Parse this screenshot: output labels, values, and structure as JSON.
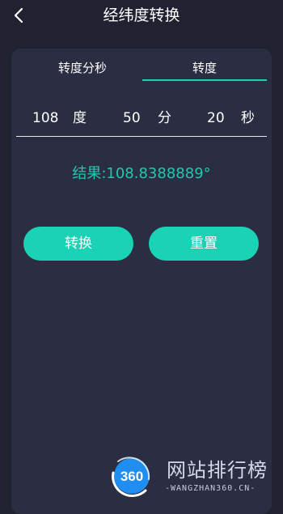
{
  "header": {
    "title": "经纬度转换"
  },
  "tabs": [
    {
      "label": "转度分秒"
    },
    {
      "label": "转度"
    }
  ],
  "inputs": {
    "degree_value": "108",
    "degree_unit": "度",
    "minute_value": "50",
    "minute_unit": "分",
    "second_value": "20",
    "second_unit": "秒"
  },
  "result": {
    "label": "结果:",
    "value": "108.8388889°"
  },
  "buttons": {
    "convert": "转换",
    "reset": "重置"
  },
  "watermark": {
    "logo_text": "360",
    "title": "网站排行榜",
    "subtitle": "-WANGZHAN360.CN-"
  },
  "colors": {
    "background": "#202231",
    "card": "#2b2d42",
    "accent": "#19d3b2"
  },
  "icons": {
    "back": "chevron-left-icon",
    "logo": "360-logo-icon"
  }
}
